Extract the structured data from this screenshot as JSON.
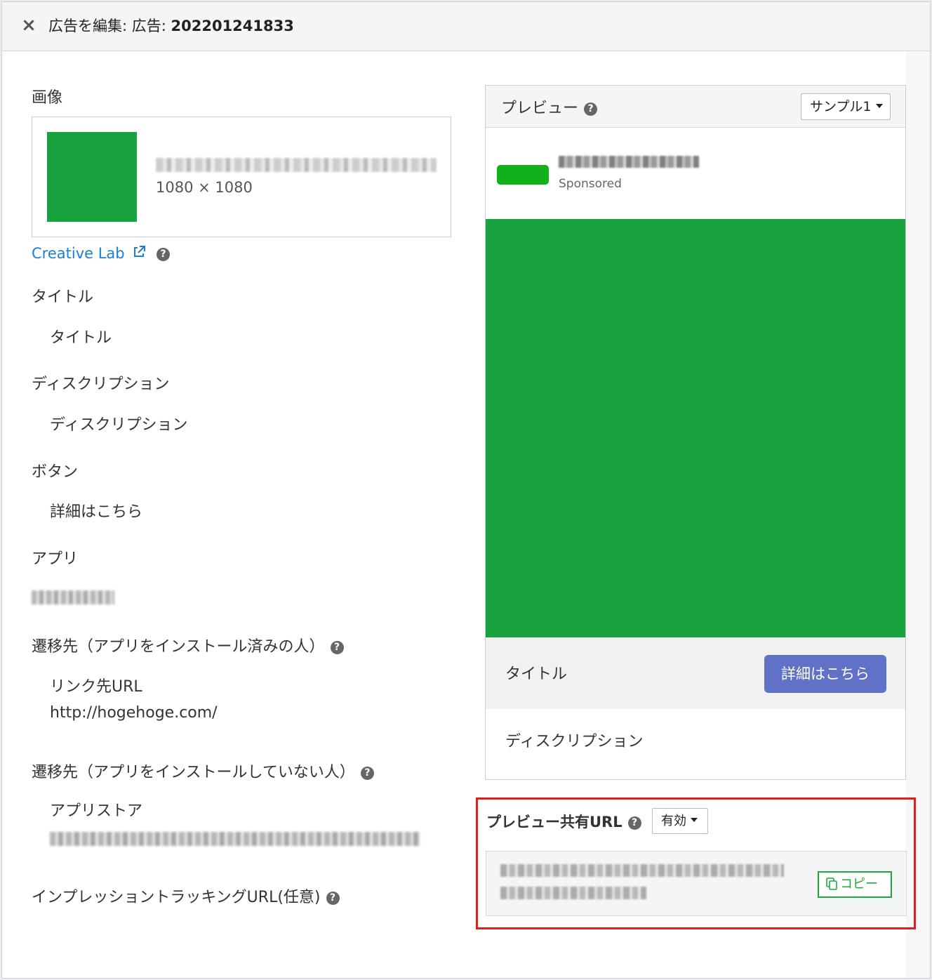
{
  "header": {
    "close_glyph": "×",
    "title_prefix": "広告を編集: 広告: ",
    "ad_id": "202201241833"
  },
  "form": {
    "image_label": "画像",
    "image_dims": "1080 × 1080",
    "creative_lab": "Creative Lab",
    "title_label": "タイトル",
    "title_value": "タイトル",
    "description_label": "ディスクリプション",
    "description_value": "ディスクリプション",
    "button_label": "ボタン",
    "button_value": "詳細はこちら",
    "app_label": "アプリ",
    "dest_installed_label": "遷移先（アプリをインストール済みの人）",
    "link_url_label": "リンク先URL",
    "link_url_value": "http://hogehoge.com/",
    "dest_not_installed_label": "遷移先（アプリをインストールしていない人）",
    "app_store_label": "アプリストア",
    "impression_tracking_label": "インプレッショントラッキングURL(任意)",
    "help_glyph": "?"
  },
  "preview": {
    "title": "プレビュー",
    "sample_select": "サンプル1",
    "sponsored": "Sponsored",
    "ad_title": "タイトル",
    "cta": "詳細はこちら",
    "ad_description": "ディスクリプション"
  },
  "share": {
    "label": "プレビュー共有URL",
    "status_select": "有効",
    "copy_label": "コピー"
  },
  "colors": {
    "image_green": "#19a33f",
    "account_green": "#12b01a",
    "cta_blue": "#5f72c8",
    "link_blue": "#1a7fd4",
    "highlight_red": "#d9221c",
    "copy_green": "#1fa83a"
  },
  "icons": {
    "close": "close-icon",
    "help": "help-circle-icon",
    "external_link": "external-link-icon",
    "dropdown": "chevron-down-icon",
    "copy": "copy-icon"
  }
}
